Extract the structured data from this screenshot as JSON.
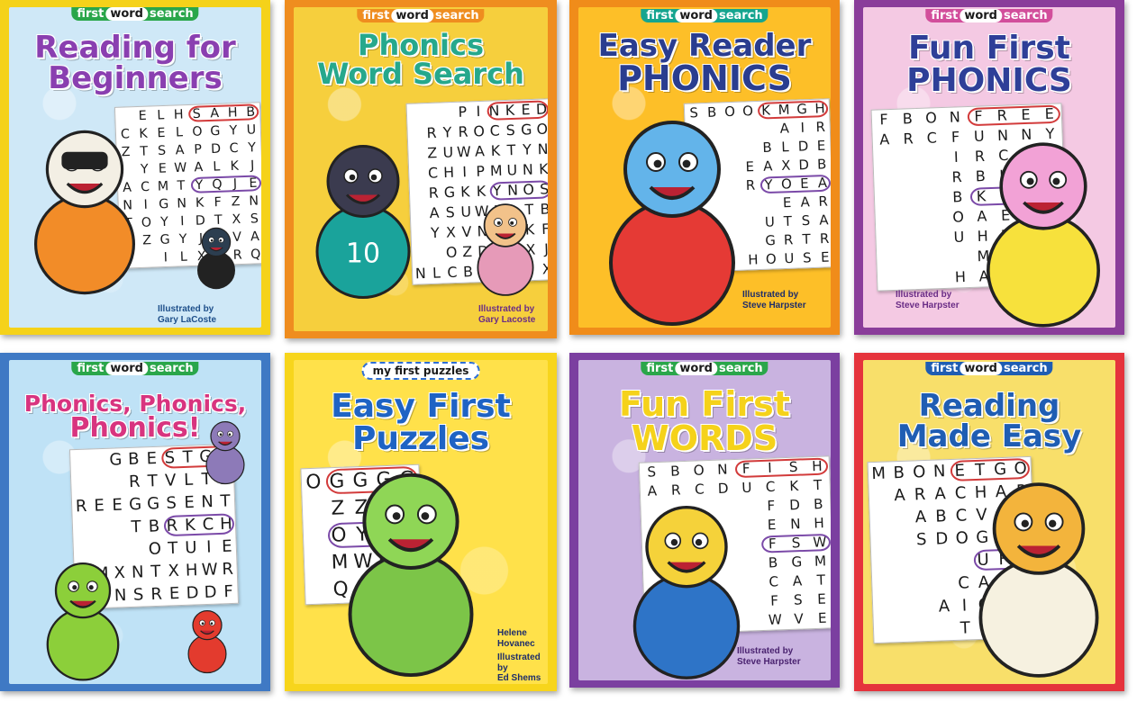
{
  "books": [
    {
      "series": {
        "pre": "first",
        "word": "word",
        "post": "search"
      },
      "title": [
        "Reading for",
        "Beginners"
      ],
      "credit": [
        "Illustrated by",
        "Gary LaCoste"
      ],
      "letters": [
        "ELHSAHB",
        "CKELOGYU",
        "ZTSAPDCY",
        "YEWALKJ",
        "ACMTYQJE",
        "NIGNKFZN",
        "TOYIDTXS",
        "JZGYJDVA",
        "ILXGRQ"
      ],
      "colors": {
        "bg": "#cfe8f7",
        "frame": "#f5d21a",
        "title": "#8a3fb0",
        "series": "#2aa64a"
      }
    },
    {
      "series": {
        "pre": "first",
        "word": "word",
        "post": "search"
      },
      "title": [
        "Phonics",
        "Word Search"
      ],
      "credit": [
        "Illustrated by",
        "Gary Lacoste"
      ],
      "letters": [
        "PINKED",
        "RYROCSGO",
        "ZUWAKTYN",
        "CHIPMUNK",
        "RGKKYNOS",
        "ASUWLLTB",
        "YXVNCHKF",
        "OZDPLXJ",
        "NLCBRUIJX"
      ],
      "colors": {
        "bg": "#f6cf3d",
        "frame": "#ef8d1f",
        "title": "#26a88c",
        "series": "#ef8d1f"
      }
    },
    {
      "series": {
        "pre": "first",
        "word": "word",
        "post": "search"
      },
      "title": [
        "Easy Reader",
        "PHONICS"
      ],
      "credit": [
        "Illustrated by",
        "Steve Harpster"
      ],
      "letters": [
        "SBOOKMGH",
        "AIR",
        "BLDE",
        "EAXDB",
        "RYOEA",
        "EAR",
        "UTSA",
        "GRTR",
        "HOUSE"
      ],
      "colors": {
        "bg": "#fdbf28",
        "frame": "#f08c1a",
        "title": "#2a3d8f",
        "series": "#15a58f"
      }
    },
    {
      "series": {
        "pre": "first",
        "word": "word",
        "post": "search"
      },
      "title": [
        "Fun First",
        "PHONICS"
      ],
      "credit": [
        "Illustrated by",
        "Steve Harpster"
      ],
      "letters": [
        "FBONFREE",
        "ARCFUNNY",
        "IRCFI",
        "RBKAT",
        "BKCOT",
        "OAEME",
        "UHNTC",
        "MAEA",
        "HAXAY"
      ],
      "colors": {
        "bg": "#f4c9e3",
        "frame": "#8a3d9a",
        "title": "#2e3f98",
        "series": "#d24e9b"
      }
    },
    {
      "series": {
        "pre": "first",
        "word": "word",
        "post": "search"
      },
      "title": [
        "Phonics, Phonics,",
        "Phonics!"
      ],
      "credit": [],
      "letters": [
        "GBESTGE",
        "RTVLTR",
        "REEGGSENT",
        "TBRKCH",
        "OTUIE",
        "MXNTXHWR",
        "TNSREDDF"
      ],
      "colors": {
        "bg": "#bfe2f6",
        "frame": "#3f79c4",
        "title": "#d8347f",
        "series": "#2aa64a"
      }
    },
    {
      "series": {
        "pre": "my first puzzles",
        "word": "",
        "post": ""
      },
      "title": [
        "Easy First",
        "Puzzles"
      ],
      "credit": [
        "Helene",
        "Hovanec",
        "Illustrated by",
        "Ed Shems"
      ],
      "letters": [
        "OGGGG",
        "ZZZZ",
        "OYOY",
        "MWMW",
        "QOQO"
      ],
      "colors": {
        "bg": "#ffe14a",
        "frame": "#f7d51c",
        "title": "#1e63c4",
        "series": "#2f6fd6"
      }
    },
    {
      "series": {
        "pre": "first",
        "word": "word",
        "post": "search"
      },
      "title": [
        "Fun First",
        "WORDS"
      ],
      "credit": [
        "Illustrated by",
        "Steve Harpster"
      ],
      "letters": [
        "SBONFISH",
        "ARCDUCKT",
        "FDB",
        "ENH",
        "FSW",
        "BGM",
        "CAT",
        "FSE",
        "WVE"
      ],
      "colors": {
        "bg": "#c9b3e0",
        "frame": "#7b3fa0",
        "title": "#f5d21a",
        "series": "#2aa64a"
      }
    },
    {
      "series": {
        "pre": "first",
        "word": "word",
        "post": "search"
      },
      "title": [
        "Reading",
        "Made Easy"
      ],
      "credit": [],
      "letters": [
        "MBONETGO",
        "ARACHAP",
        "ABCVFI",
        "SDOGPL",
        "UFR",
        "CASJ",
        "AIOSJ",
        "TCCP"
      ],
      "colors": {
        "bg": "#f8df6a",
        "frame": "#e5333c",
        "title": "#1f5db3",
        "series": "#1f5db3"
      }
    }
  ]
}
